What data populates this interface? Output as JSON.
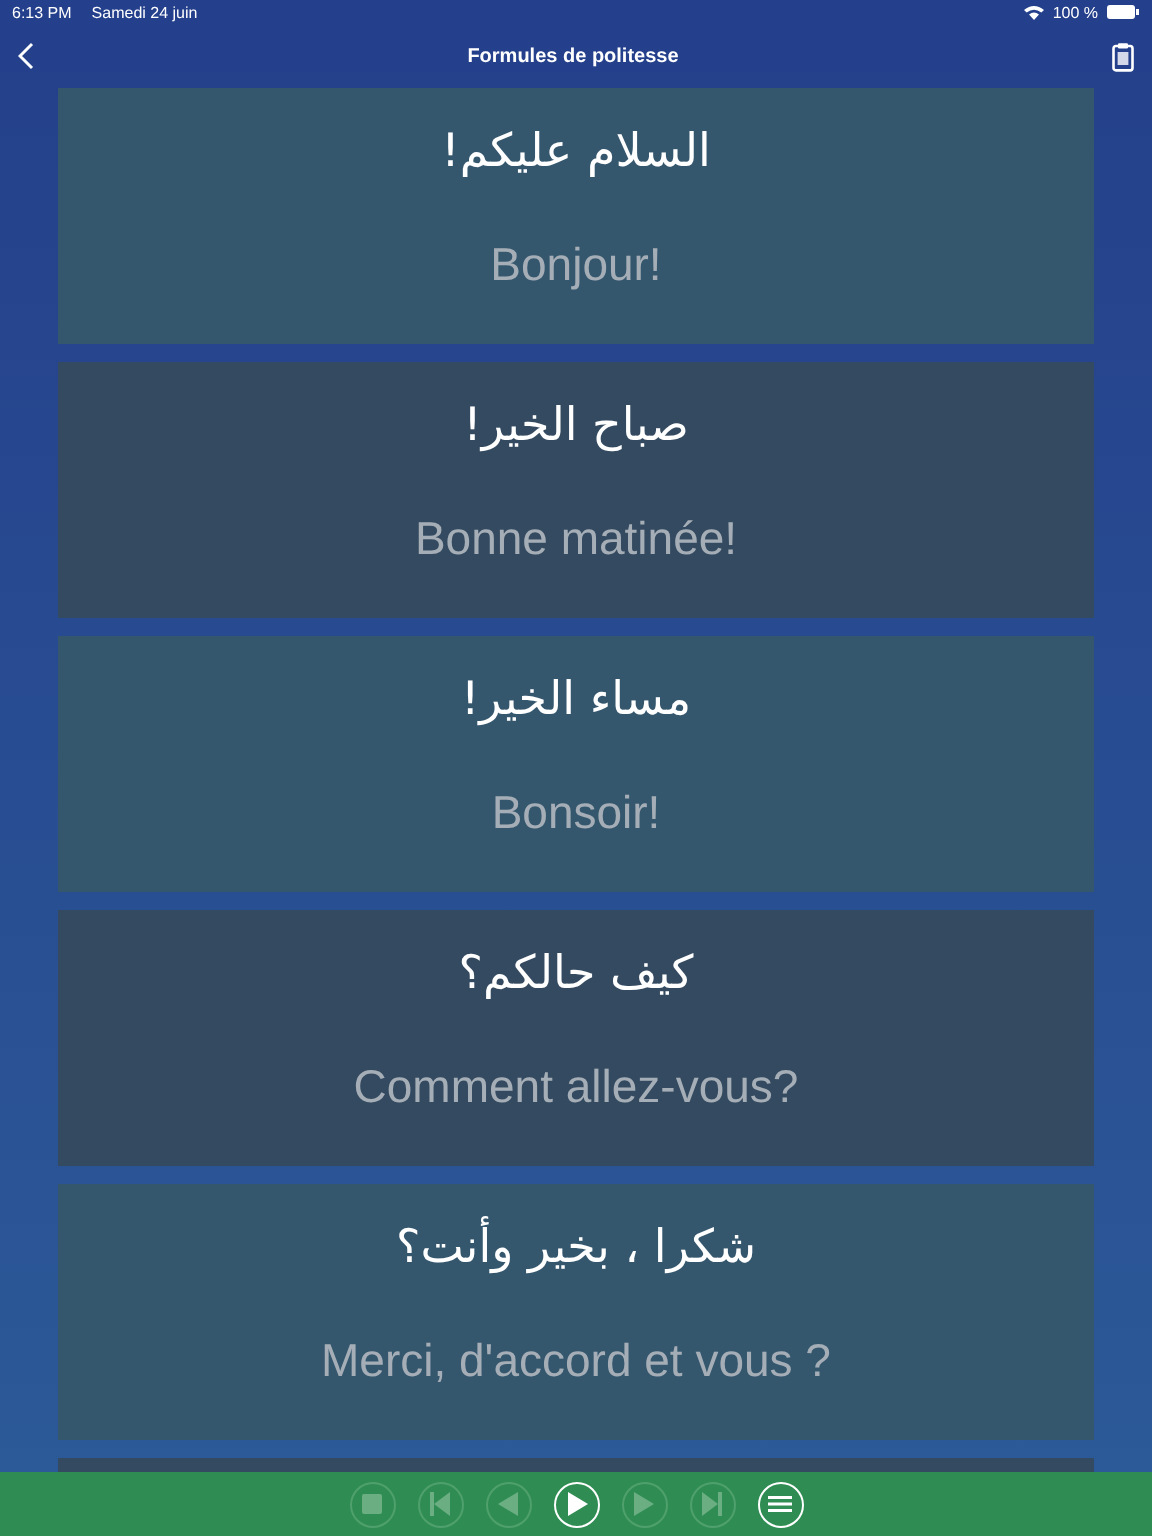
{
  "status_bar": {
    "time": "6:13 PM",
    "date": "Samedi 24 juin",
    "battery": "100 %"
  },
  "nav": {
    "title": "Formules de politesse"
  },
  "phrases": [
    {
      "arabic": "السلام عليكم!",
      "french": "Bonjour!"
    },
    {
      "arabic": "صباح الخير!",
      "french": "Bonne matinée!"
    },
    {
      "arabic": "مساء الخير!",
      "french": "Bonsoir!"
    },
    {
      "arabic": "كيف حالكم؟",
      "french": "Comment allez-vous?"
    },
    {
      "arabic": "شكرا ، بخير وأنت؟",
      "french": "Merci, d'accord et vous ?"
    }
  ],
  "player": [
    {
      "kind": "stop",
      "disabled": true
    },
    {
      "kind": "first",
      "disabled": true
    },
    {
      "kind": "previous",
      "disabled": true
    },
    {
      "kind": "play",
      "disabled": false
    },
    {
      "kind": "next",
      "disabled": true
    },
    {
      "kind": "last",
      "disabled": true
    },
    {
      "kind": "list",
      "disabled": false
    }
  ]
}
